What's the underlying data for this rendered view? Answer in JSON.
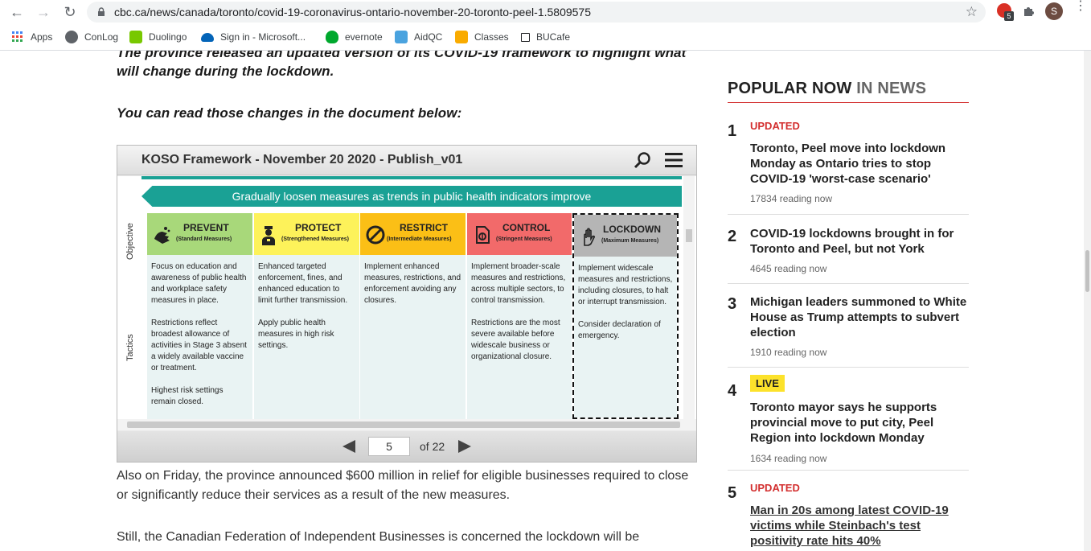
{
  "browser": {
    "url": "cbc.ca/news/canada/toronto/covid-19-coronavirus-ontario-november-20-toronto-peel-1.5809575",
    "extension_badge": "5",
    "avatar_letter": "S"
  },
  "bookmarks": [
    {
      "label": "Apps",
      "icon": "apps-grid-icon",
      "color": "#4285f4"
    },
    {
      "label": "ConLog",
      "icon": "globe-icon",
      "color": "#5f6368"
    },
    {
      "label": "Duolingo",
      "icon": "duolingo-icon",
      "color": "#78c800"
    },
    {
      "label": "Sign in - Microsoft...",
      "icon": "onedrive-cloud-icon",
      "color": "#0364b8"
    },
    {
      "label": "evernote",
      "icon": "evernote-icon",
      "color": "#00a82d"
    },
    {
      "label": "AidQC",
      "icon": "aidqc-icon",
      "color": "#4aa3df"
    },
    {
      "label": "Classes",
      "icon": "classroom-icon",
      "color": "#f9ab00"
    },
    {
      "label": "BUCafe",
      "icon": "square-icon",
      "color": "#202124"
    }
  ],
  "article": {
    "lead_line1": "The province released an updated version of its COVID-19 framework to highlight what",
    "lead_line2": "will change during the lockdown.",
    "read_changes": "You can read those changes in the document below:",
    "para1": "Also on Friday, the province announced $600 million in relief for eligible businesses required to close or significantly reduce their services as a result of the new measures.",
    "para2": "Still, the Canadian Federation of Independent Businesses is concerned the lockdown will be"
  },
  "viewer": {
    "title": "KOSO Framework - November 20 2020 - Publish_v01",
    "banner": "Gradually loosen measures as trends in public health indicators improve",
    "label_objective": "Objective",
    "label_tactics": "Tactics",
    "page_current": "5",
    "page_total_label": "of 22",
    "stages": [
      {
        "title": "PREVENT",
        "subtitle": "(Standard Measures)",
        "color": "#a8d87a",
        "icon": "washing-hands-icon",
        "paragraphs": [
          "Focus on education and awareness of public health and workplace safety measures in place.",
          "Restrictions reflect broadest allowance of activities in Stage 3 absent a widely available vaccine or treatment.",
          "Highest risk settings remain closed."
        ]
      },
      {
        "title": "PROTECT",
        "subtitle": "(Strengthened Measures)",
        "color": "#fdf25a",
        "icon": "officer-icon",
        "paragraphs": [
          "Enhanced targeted enforcement, fines, and enhanced education to limit further transmission.",
          "Apply public health measures in high risk settings."
        ]
      },
      {
        "title": "RESTRICT",
        "subtitle": "(Intermediate Measures)",
        "color": "#fbbf16",
        "icon": "no-entry-icon",
        "paragraphs": [
          "Implement enhanced measures, restrictions, and enforcement avoiding any closures."
        ]
      },
      {
        "title": "CONTROL",
        "subtitle": "(Stringent Measures)",
        "color": "#f26a6a",
        "icon": "document-shield-icon",
        "paragraphs": [
          "Implement broader-scale measures and restrictions, across multiple sectors, to control transmission.",
          "Restrictions are the most severe available before widescale business or organizational closure."
        ]
      },
      {
        "title": "LOCKDOWN",
        "subtitle": "(Maximum Measures)",
        "color": "#b5b5b5",
        "icon": "stop-hand-icon",
        "paragraphs": [
          "Implement widescale measures and restrictions, including closures, to halt or interrupt transmission.",
          "Consider declaration of emergency."
        ]
      }
    ]
  },
  "popular": {
    "title_main": "POPULAR NOW",
    "title_accent": "IN NEWS",
    "items": [
      {
        "num": "1",
        "flag": "UPDATED",
        "headline": "Toronto, Peel move into lockdown Monday as Ontario tries to stop COVID-19 'worst-case scenario'",
        "reading": "17834 reading now"
      },
      {
        "num": "2",
        "flag": "",
        "headline": "COVID-19 lockdowns brought in for Toronto and Peel, but not York",
        "reading": "4645 reading now"
      },
      {
        "num": "3",
        "flag": "",
        "headline": "Michigan leaders summoned to White House as Trump attempts to subvert election",
        "reading": "1910 reading now"
      },
      {
        "num": "4",
        "flag": "LIVE",
        "headline": "Toronto mayor says he supports provincial move to put city, Peel Region into lockdown Monday",
        "reading": "1634 reading now"
      },
      {
        "num": "5",
        "flag": "UPDATED",
        "headline": "Man in 20s among latest COVID-19 victims while Steinbach's test positivity rate hits 40%",
        "reading": ""
      }
    ]
  }
}
